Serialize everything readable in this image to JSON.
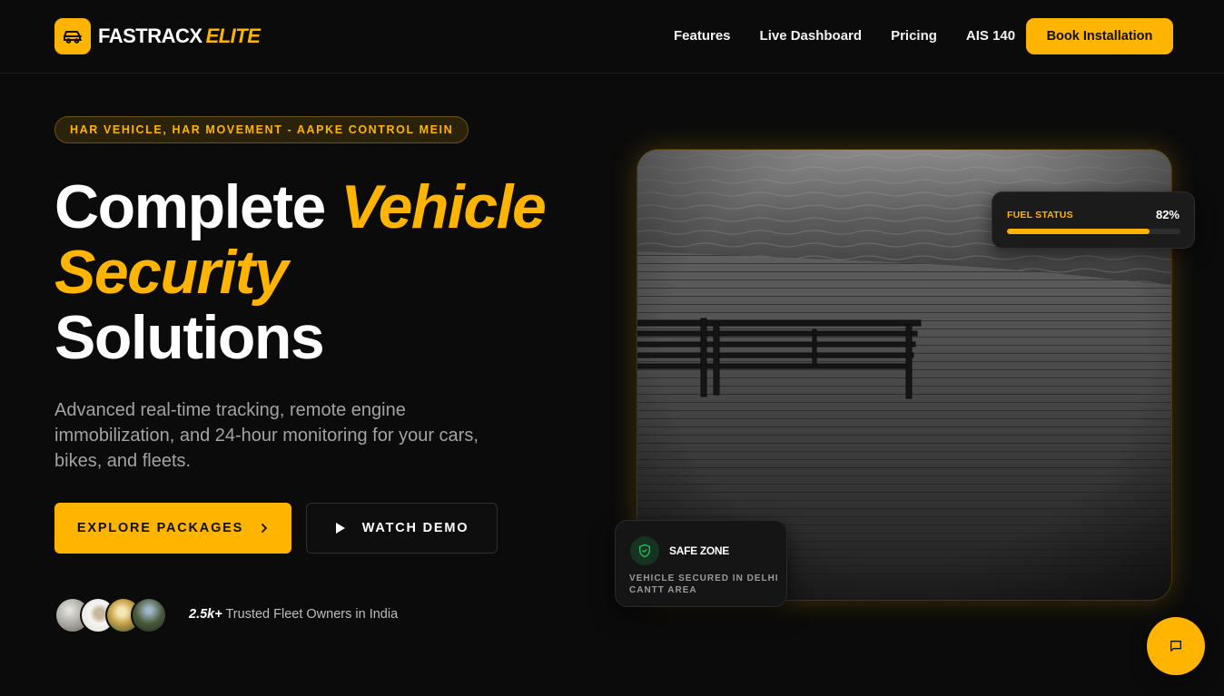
{
  "nav": {
    "brand_main": "FASTRACX",
    "brand_accent": "ELITE",
    "logo_icon": "car-icon",
    "links": [
      "Features",
      "Live Dashboard",
      "Pricing",
      "AIS 140"
    ],
    "cta": "Book Installation"
  },
  "hero": {
    "tagline": "HAR VEHICLE, HAR MOVEMENT - AAPKE CONTROL MEIN",
    "headline_1": "Complete",
    "headline_accent_1": "Vehicle",
    "headline_accent_2": "Security",
    "headline_3": "Solutions",
    "subtext": "Advanced real-time tracking, remote engine immobilization, and 24-hour monitoring for your cars, bikes, and fleets.",
    "primary_button": "EXPLORE PACKAGES",
    "secondary_button": "WATCH DEMO",
    "trust_count": "2.5k+",
    "trust_text": "Trusted Fleet Owners in India"
  },
  "fuel": {
    "label": "FUEL STATUS",
    "value": "82%",
    "level": 0.82
  },
  "safe_zone": {
    "title": "SAFE ZONE",
    "description": "VEHICLE SECURED IN DELHI CANTT AREA",
    "icon": "shield-check-icon"
  },
  "chat": {
    "icon": "chat-bubble-icon"
  },
  "colors": {
    "accent": "#ffb400",
    "background": "#0b0b0b",
    "safe_green": "#22c55e"
  }
}
